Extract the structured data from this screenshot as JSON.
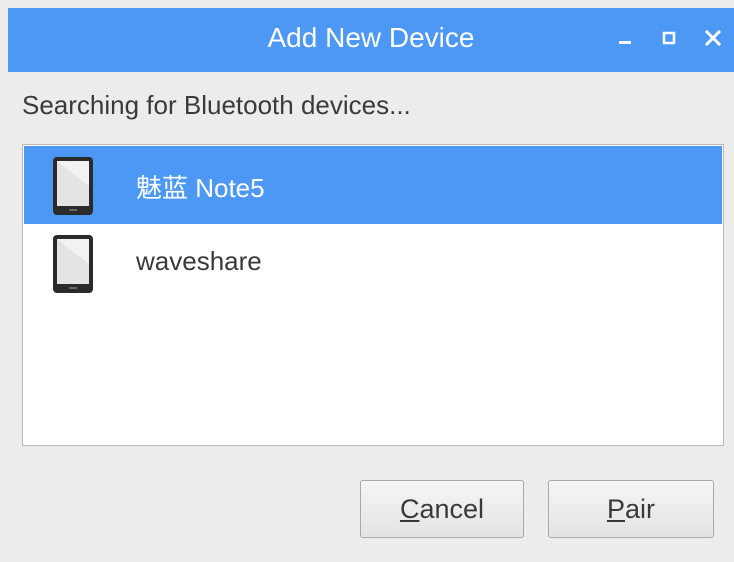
{
  "window": {
    "title": "Add New Device",
    "controls": [
      "minimize",
      "maximize",
      "close"
    ]
  },
  "status_text": "Searching for Bluetooth devices...",
  "devices": [
    {
      "name": "魅蓝 Note5",
      "icon": "tablet-icon",
      "selected": true
    },
    {
      "name": "waveshare",
      "icon": "tablet-icon",
      "selected": false
    }
  ],
  "buttons": {
    "cancel": {
      "mnemonic": "C",
      "rest": "ancel"
    },
    "pair": {
      "mnemonic": "P",
      "rest": "air"
    }
  },
  "colors": {
    "accent": "#4d98f5",
    "background": "#edeceb",
    "text": "#3a3a3a"
  }
}
